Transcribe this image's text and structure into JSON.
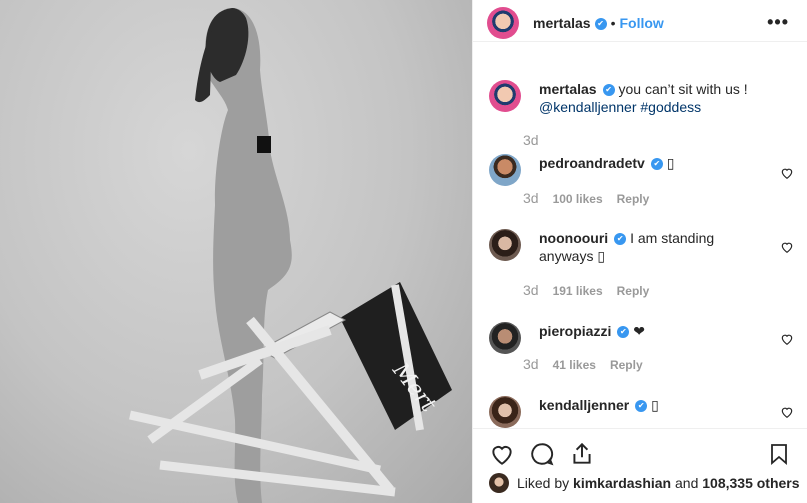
{
  "header": {
    "username": "mertalas",
    "follow_label": "Follow",
    "more_label": "•••"
  },
  "photo": {
    "signature_text": "Mert"
  },
  "caption": {
    "username": "mertalas",
    "text": "you can’t sit with us !",
    "mention": "@kendalljenner",
    "hashtag": "#goddess",
    "time": "3d"
  },
  "comments": [
    {
      "username": "pedroandradetv",
      "text": "▯",
      "time": "3d",
      "likes": "100 likes",
      "reply": "Reply"
    },
    {
      "username": "noonoouri",
      "text": "I am standing anyways ▯",
      "time": "3d",
      "likes": "191 likes",
      "reply": "Reply"
    },
    {
      "username": "pieropiazzi",
      "text": "❤",
      "time": "3d",
      "likes": "41 likes",
      "reply": "Reply"
    },
    {
      "username": "kendalljenner",
      "text": "▯"
    }
  ],
  "likes": {
    "prefix": "Liked by",
    "user": "kimkardashian",
    "mid": "and",
    "others": "108,335 others"
  },
  "colors": {
    "link": "#3897f0",
    "verified": "#3897f0"
  },
  "icons": [
    "heart-icon",
    "comment-icon",
    "share-icon",
    "bookmark-icon",
    "more-icon",
    "verified-icon"
  ]
}
